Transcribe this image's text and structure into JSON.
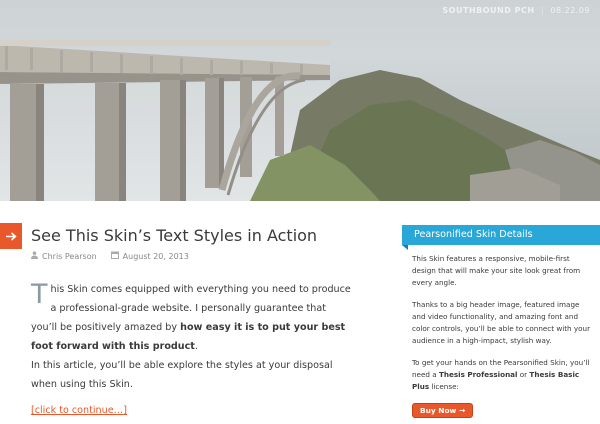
{
  "hero": {
    "caption_location": "SOUTHBOUND PCH",
    "caption_separator": "|",
    "caption_date": "08.22.09",
    "image_subject": "bixby-bridge-coastline"
  },
  "post": {
    "title": "See This Skin’s Text Styles in Action",
    "author": "Chris Pearson",
    "date": "August 20, 2013",
    "dropcap": "T",
    "p1_rest": "his Skin comes equipped with everything you need to produce a professional-grade website. I personally guarantee that you’ll be positively amazed by ",
    "p1_bold": "how easy it is to put your best foot forward with this product",
    "p1_end": ".",
    "p2": "In this article, you’ll be able explore the styles at your disposal when using this Skin.",
    "more_link": "[click to continue…]"
  },
  "sidebar": {
    "title": "Pearsonified Skin Details",
    "p1": "This Skin features a responsive, mobile-first design that will make your site look great from every angle.",
    "p2": "Thanks to a big header image, featured image and video functionality, and amazing font and color controls, you’ll be able to connect with your audience in a high-impact, stylish way.",
    "p3_a": "To get your hands on the Pearsonified Skin, you’ll need a ",
    "p3_b": "Thesis Professional",
    "p3_c": " or ",
    "p3_d": "Thesis Basic Plus",
    "p3_e": " license:",
    "button": "Buy Now →"
  },
  "colors": {
    "accent_orange": "#e8582a",
    "accent_blue": "#29a7d7",
    "text": "#3a3a3a",
    "meta": "#888888"
  }
}
